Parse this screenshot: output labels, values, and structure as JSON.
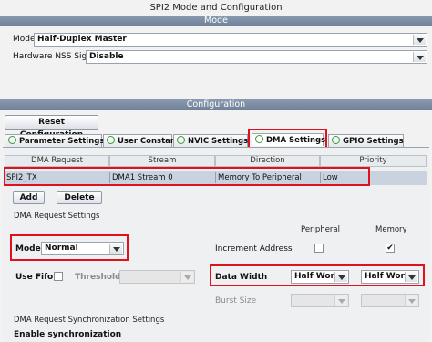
{
  "window_title": "SPI2 Mode and Configuration",
  "mode_section": {
    "header": "Mode",
    "mode_label": "Mode",
    "mode_value": "Half-Duplex Master",
    "nss_label": "Hardware NSS Signal",
    "nss_value": "Disable"
  },
  "config_section": {
    "header": "Configuration",
    "reset_button": "Reset Configuration",
    "tabs": [
      {
        "label": "Parameter Settings"
      },
      {
        "label": "User Constants"
      },
      {
        "label": "NVIC Settings"
      },
      {
        "label": "DMA Settings"
      },
      {
        "label": "GPIO Settings"
      }
    ]
  },
  "dma_table": {
    "columns": [
      "DMA Request",
      "Stream",
      "Direction",
      "Priority"
    ],
    "rows": [
      {
        "request": "SPI2_TX",
        "stream": "DMA1 Stream 0",
        "direction": "Memory To Peripheral",
        "priority": "Low"
      }
    ]
  },
  "buttons": {
    "add": "Add",
    "delete": "Delete"
  },
  "dma_request_settings": {
    "header": "DMA Request Settings",
    "peripheral_col": "Peripheral",
    "memory_col": "Memory",
    "mode_label": "Mode",
    "mode_value": "Normal",
    "increment_label": "Increment Address",
    "increment_peripheral": false,
    "increment_memory": true,
    "fifo_label": "Use Fifo",
    "threshold_label": "Threshold",
    "data_width_label": "Data Width",
    "data_width_peripheral": "Half Word",
    "data_width_memory": "Half Word",
    "burst_label": "Burst Size"
  },
  "sync_settings": {
    "header": "DMA Request Synchronization Settings",
    "enable_label": "Enable synchronization"
  },
  "colors": {
    "highlight": "#e0111d",
    "selected_row": "#c9d3e0",
    "section_bar": "#7a8ba2"
  }
}
